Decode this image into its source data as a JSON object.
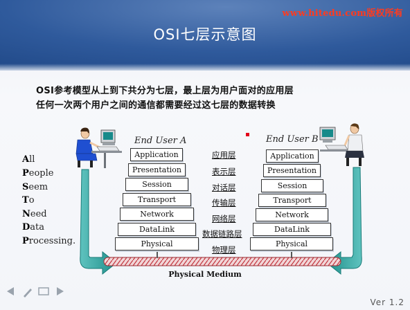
{
  "header": {
    "watermark": "www.hitedu.com版权所有",
    "title": "OSI七层示意图"
  },
  "intro": {
    "line1": "OSI参考模型从上到下共分为七层，最上层为用户面对的应用层",
    "line2": "任何一次两个用户之间的通信都需要经过这七层的数据转换"
  },
  "diagram": {
    "user_a": "End User A",
    "user_b": "End User B",
    "layers": [
      "Application",
      "Presentation",
      "Session",
      "Transport",
      "Network",
      "DataLink",
      "Physical"
    ],
    "layers_cn": [
      "应用层",
      "表示层",
      "对话层",
      "传输层",
      "网络层",
      "数据链路层",
      "物理层"
    ],
    "medium": "Physical Medium"
  },
  "mnemonic": [
    {
      "initial": "A",
      "rest": "ll"
    },
    {
      "initial": "P",
      "rest": "eople"
    },
    {
      "initial": "S",
      "rest": "eem"
    },
    {
      "initial": "T",
      "rest": "o"
    },
    {
      "initial": "N",
      "rest": "eed"
    },
    {
      "initial": "D",
      "rest": "ata"
    },
    {
      "initial": "P",
      "rest": "rocessing."
    }
  ],
  "footer": {
    "version": "Ver 1.2"
  },
  "controls": [
    "back-arrow-icon",
    "pen-icon",
    "menu-icon",
    "forward-arrow-icon"
  ],
  "colors": {
    "header_dark": "#173e7b",
    "header_mid": "#2f5a9c",
    "watermark": "#ff3b1f",
    "arrow_teal": "#1f8f8a",
    "medium_red": "#c2333b"
  }
}
